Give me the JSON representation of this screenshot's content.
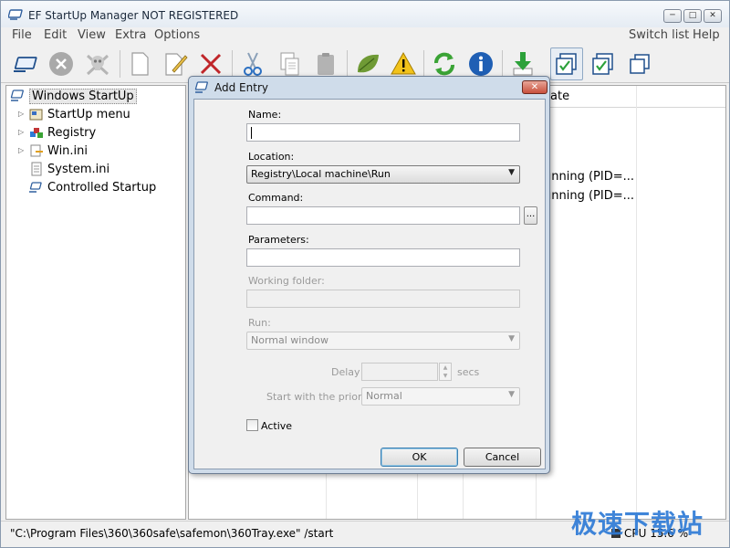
{
  "app": {
    "title": "EF StartUp Manager NOT REGISTERED",
    "window_buttons": [
      "minimize",
      "maximize",
      "close"
    ]
  },
  "menu": {
    "left": [
      "File",
      "Edit",
      "View",
      "Extra",
      "Options"
    ],
    "right": [
      "Switch list",
      "Help"
    ]
  },
  "toolbar": {
    "icons": [
      "monitor-icon",
      "stop-icon",
      "skull-icon",
      "new-document-icon",
      "edit-icon",
      "delete-icon",
      "cut-icon",
      "copy-icon",
      "paste-icon",
      "leaf-icon",
      "warning-icon",
      "refresh-icon",
      "info-icon",
      "download-icon",
      "checked-list-icon",
      "check-icon",
      "windows-icon"
    ]
  },
  "tree": {
    "root": "Windows StartUp",
    "items": [
      "StartUp menu",
      "Registry",
      "Win.ini",
      "System.ini",
      "Controlled Startup"
    ]
  },
  "list": {
    "header_partial": "ate",
    "rows": [
      "unning (PID=...",
      "unning (PID=..."
    ]
  },
  "status": {
    "command": "\"C:\\Program Files\\360\\360safe\\safemon\\360Tray.exe\" /start",
    "cpu": "CPU 15.6 %"
  },
  "watermark": "极速下载站",
  "dialog": {
    "title": "Add Entry",
    "name_label": "Name:",
    "name_value": "",
    "location_label": "Location:",
    "location_value": "Registry\\Local machine\\Run",
    "command_label": "Command:",
    "command_value": "",
    "browse_label": "...",
    "parameters_label": "Parameters:",
    "parameters_value": "",
    "working_folder_label": "Working folder:",
    "working_folder_value": "",
    "run_label": "Run:",
    "run_value": "Normal window",
    "delay_label": "Delay",
    "delay_value": "",
    "delay_unit": "secs",
    "priority_label": "Start with the priority:",
    "priority_value": "Normal",
    "active_label": "Active",
    "active_checked": false,
    "ok_label": "OK",
    "cancel_label": "Cancel"
  }
}
